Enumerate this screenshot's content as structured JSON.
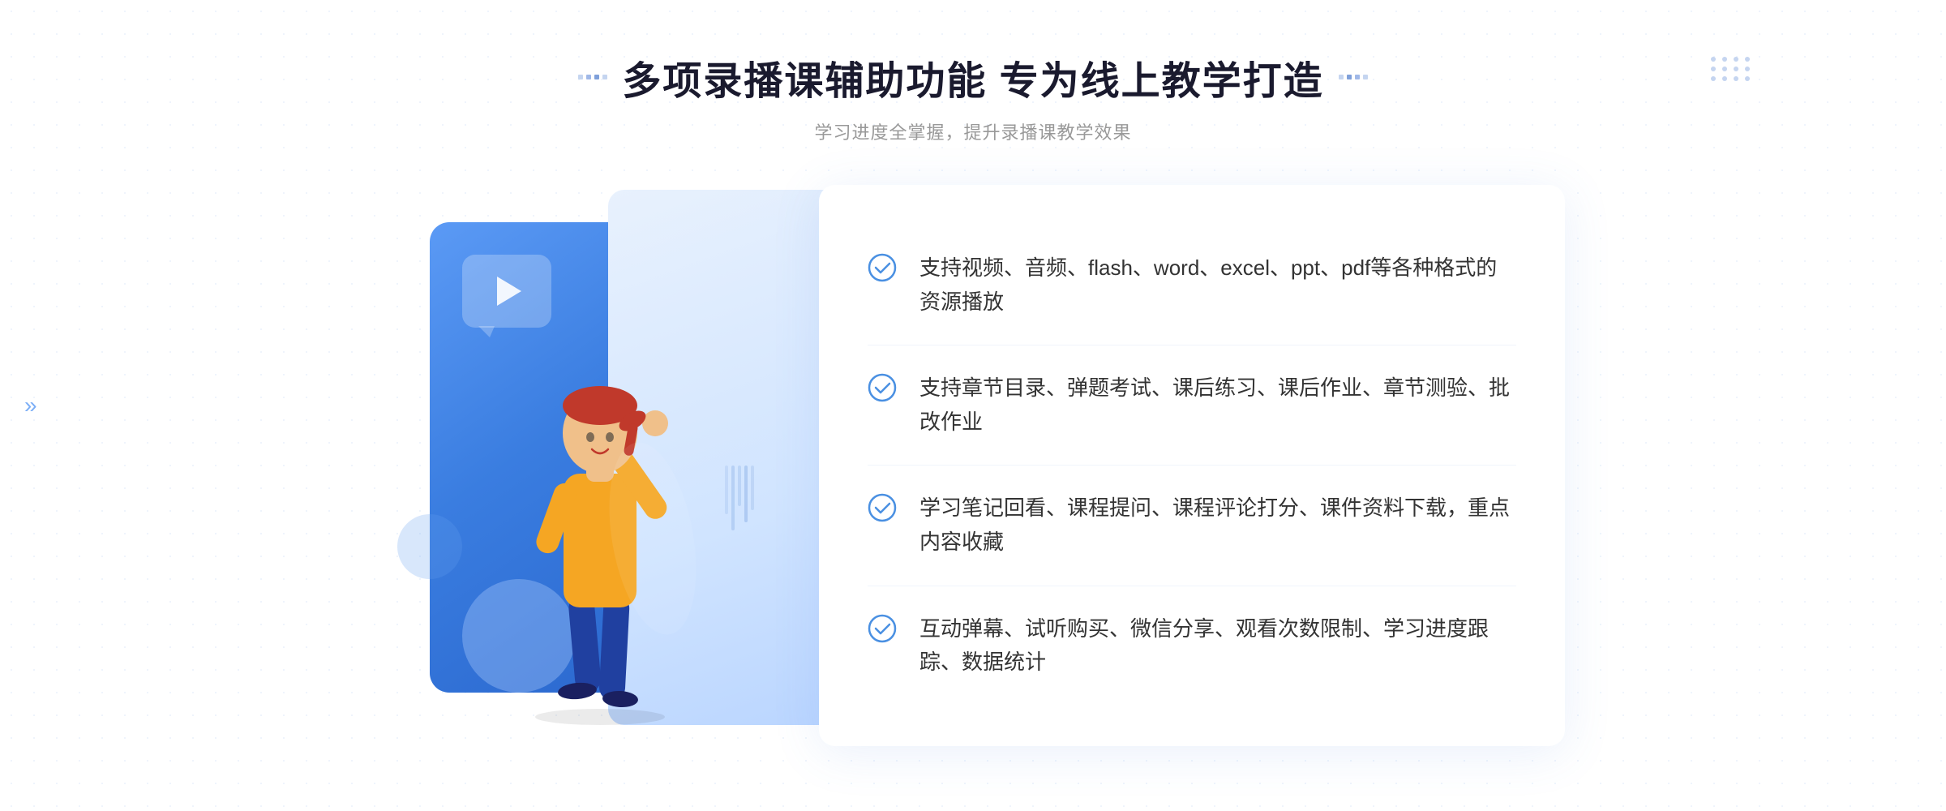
{
  "header": {
    "title": "多项录播课辅助功能 专为线上教学打造",
    "subtitle": "学习进度全掌握，提升录播课教学效果",
    "deco_left": [
      "·",
      "·",
      "·"
    ],
    "deco_right": [
      "·",
      "·",
      "·"
    ]
  },
  "features": [
    {
      "id": "feature-1",
      "text": "支持视频、音频、flash、word、excel、ppt、pdf等各种格式的资源播放"
    },
    {
      "id": "feature-2",
      "text": "支持章节目录、弹题考试、课后练习、课后作业、章节测验、批改作业"
    },
    {
      "id": "feature-3",
      "text": "学习笔记回看、课程提问、课程评论打分、课件资料下载，重点内容收藏"
    },
    {
      "id": "feature-4",
      "text": "互动弹幕、试听购买、微信分享、观看次数限制、学习进度跟踪、数据统计"
    }
  ],
  "icons": {
    "check": "check-circle-icon",
    "play": "play-icon",
    "chevron": "chevron-right-icon"
  },
  "colors": {
    "primary": "#4080e8",
    "primary_dark": "#2560c8",
    "primary_light": "#d0e4ff",
    "text_dark": "#1a1a2e",
    "text_muted": "#999999",
    "text_body": "#333333",
    "white": "#ffffff",
    "border": "#f0f4fc"
  }
}
